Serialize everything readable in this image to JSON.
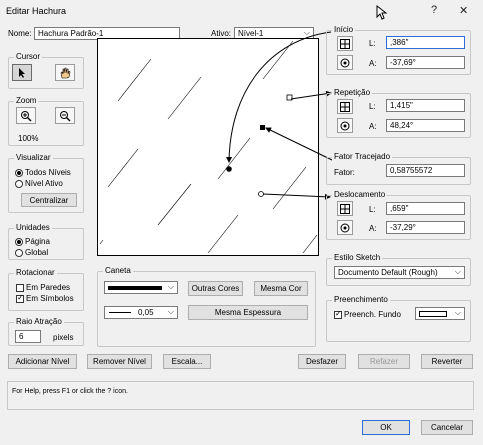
{
  "window": {
    "title": "Editar Hachura",
    "help_btn": "?",
    "close_btn": "✕"
  },
  "header": {
    "name_label": "Nome:",
    "name_value": "Hachura Padrão-1",
    "active_label": "Ativo:",
    "active_value": "Nível-1"
  },
  "cursor": {
    "title": "Cursor"
  },
  "zoom": {
    "title": "Zoom",
    "percent": "100%"
  },
  "view": {
    "title": "Visualizar",
    "options": [
      "Todos Níveis",
      "Nível Ativo"
    ],
    "selected": 0,
    "center_btn": "Centralizar"
  },
  "units": {
    "title": "Unidades",
    "options": [
      "Página",
      "Global"
    ],
    "selected": 0
  },
  "rotate": {
    "title": "Rotacionar",
    "options": [
      "Em Paredes",
      "Em Símbolos"
    ],
    "checked": [
      false,
      true
    ]
  },
  "snap": {
    "title": "Raio Atração",
    "value": "6",
    "unit": "pixels"
  },
  "pen": {
    "title": "Caneta",
    "thickness_value": "0,05",
    "other_colors_btn": "Outras Cores",
    "same_color_btn": "Mesma Cor",
    "same_thickness_btn": "Mesma Espessura"
  },
  "start": {
    "title": "Início",
    "l_label": "L:",
    "l_value": ",386\"",
    "a_label": "A:",
    "a_value": "-37,69°"
  },
  "repeat": {
    "title": "Repetição",
    "l_label": "L:",
    "l_value": "1,415\"",
    "a_label": "A:",
    "a_value": "48,24°"
  },
  "dash": {
    "title": "Fator Tracejado",
    "factor_label": "Fator:",
    "factor_value": "0,58755572"
  },
  "offset": {
    "title": "Deslocamento",
    "l_label": "L:",
    "l_value": ",659\"",
    "a_label": "A:",
    "a_value": "-37,29°"
  },
  "sketch": {
    "title": "Estilo Sketch",
    "value": "Documento Default (Rough)"
  },
  "fill": {
    "title": "Preenchimento",
    "check_label": "Preench. Fundo",
    "checked": true
  },
  "bottom": {
    "add_level": "Adicionar Nível",
    "remove_level": "Remover Nível",
    "scale": "Escala...",
    "undo": "Desfazer",
    "redo": "Refazer",
    "revert": "Reverter"
  },
  "status_text": "For Help, press F1 or click the ? icon.",
  "footer": {
    "ok": "OK",
    "cancel": "Cancelar"
  }
}
